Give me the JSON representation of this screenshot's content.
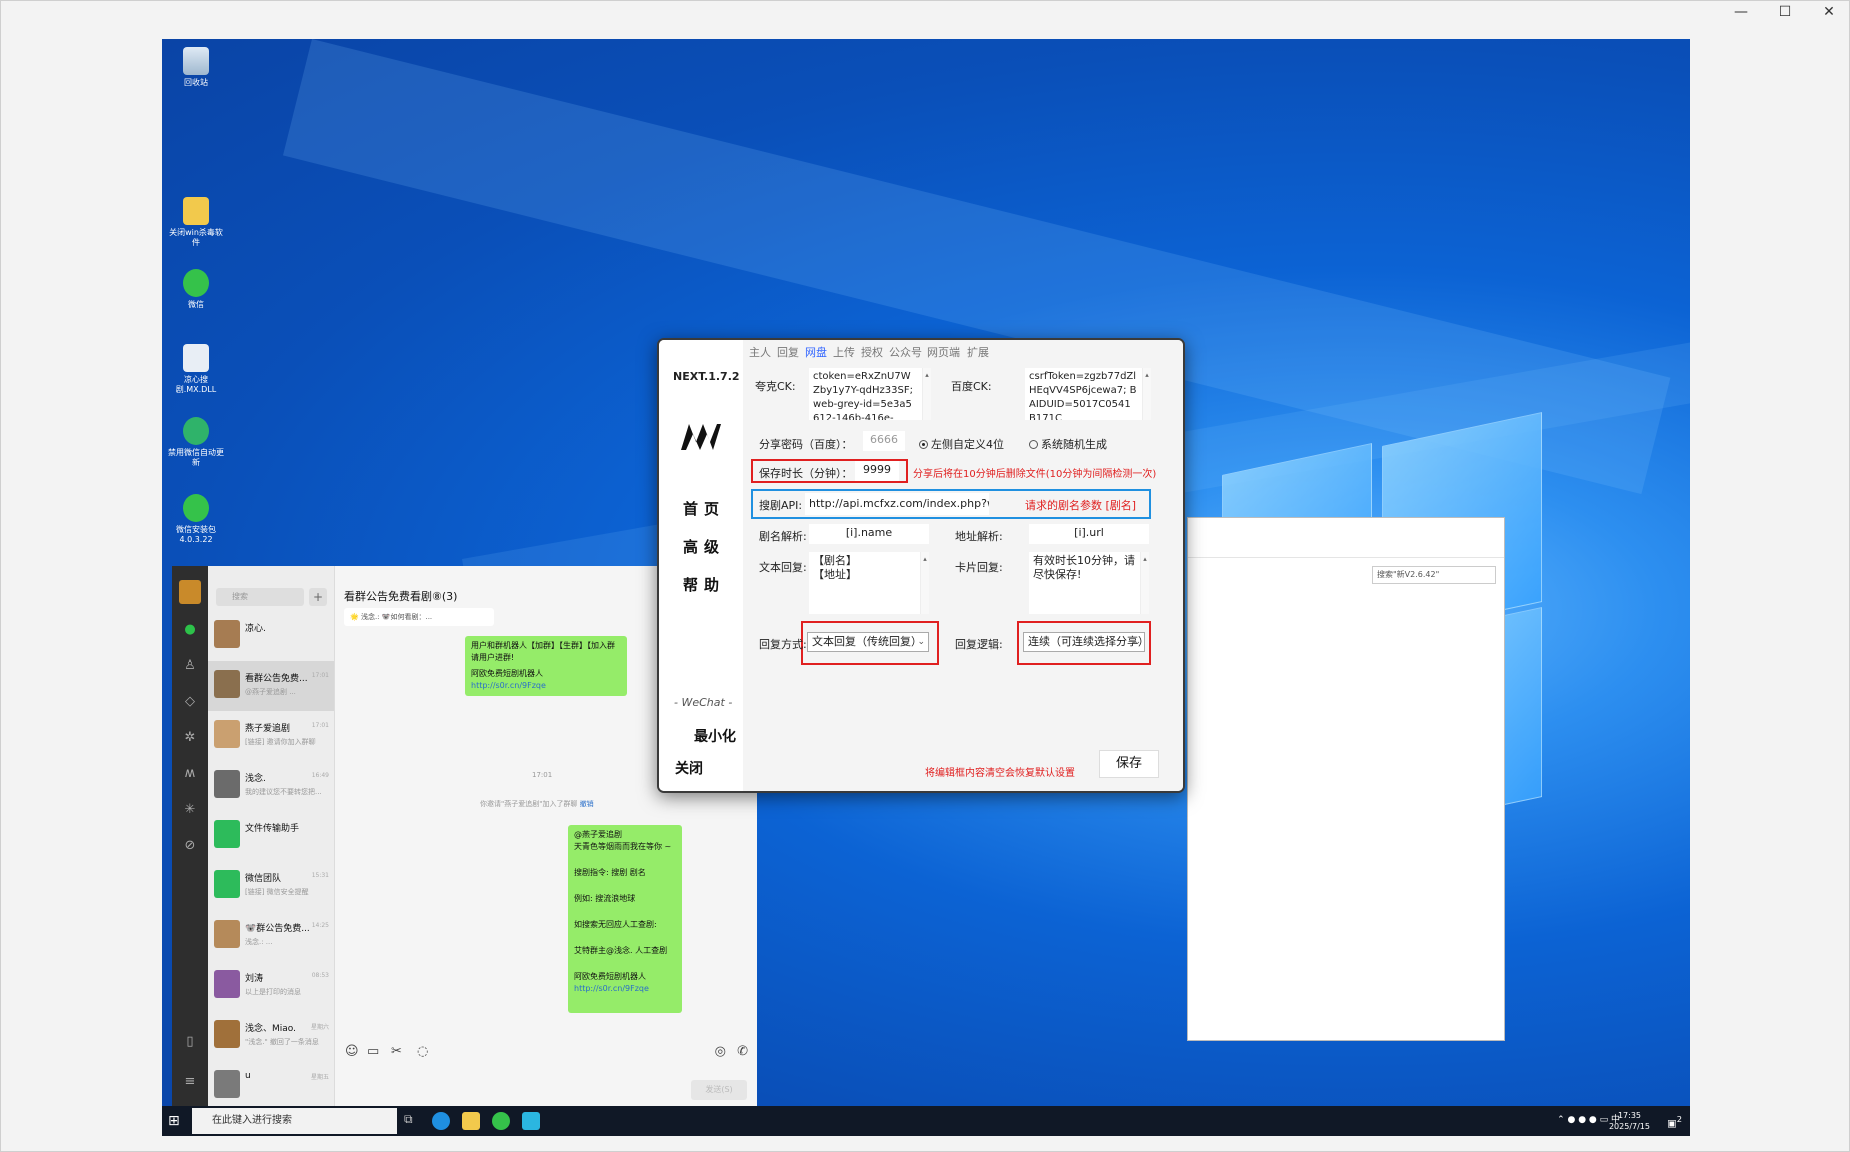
{
  "window": {
    "minimize": "—",
    "maximize": "☐",
    "close": "✕"
  },
  "desktop": {
    "icons": [
      {
        "label": "回收站"
      },
      {
        "label": "关闭win杀毒软件"
      },
      {
        "label": "微信"
      },
      {
        "label": "凉心搜剧.MX.DLL"
      },
      {
        "label": "禁用微信自动更新"
      },
      {
        "label": "微信安装包4.0.3.22"
      }
    ]
  },
  "taskbar": {
    "search_placeholder": "在此键入进行搜索",
    "time": "17:35",
    "date": "2025/7/15",
    "notif_count": "2"
  },
  "explorer": {
    "search_placeholder": "搜索\"新V2.6.42\""
  },
  "wechat": {
    "search_placeholder": "搜索",
    "plus": "+",
    "chat_title": "看群公告免费看剧⑧(3)",
    "pinned": "🌟 浅念.: 🐨如何看剧：...",
    "contacts": [
      {
        "name": "凉心.",
        "preview": "",
        "time": ""
      },
      {
        "name": "看群公告免费...",
        "preview": "@燕子爱追剧 ...",
        "time": "17:01"
      },
      {
        "name": "燕子爱追剧",
        "preview": "[链接] 邀请你加入群聊",
        "time": "17:01"
      },
      {
        "name": "浅念.",
        "preview": "我的建议您不要转您把...",
        "time": "16:49"
      },
      {
        "name": "文件传输助手",
        "preview": "",
        "time": ""
      },
      {
        "name": "微信团队",
        "preview": "[链接] 微信安全提醒",
        "time": "15:31"
      },
      {
        "name": "🐨群公告免费...",
        "preview": "浅念.: ...",
        "time": "14:25"
      },
      {
        "name": "刘涛",
        "preview": "以上是打印的消息",
        "time": "08:53"
      },
      {
        "name": "浅念、Miao.",
        "preview": "\"浅念.\" 撤回了一条消息",
        "time": "星期六"
      },
      {
        "name": "u",
        "preview": "",
        "time": "星期五"
      }
    ],
    "bubble1": {
      "line1": "用户和群机器人【加群】【生群】【加入群",
      "line2": "请用户进群!",
      "line3": "阿欧免费短剧机器人",
      "link": "http://s0r.cn/9Fzqe"
    },
    "sys_time": "17:01",
    "sys_msg": "你邀请\"燕子爱追剧\"加入了群聊",
    "sys_link": "撤销",
    "bubble2": {
      "l1": "@燕子爱追剧",
      "l2": "天青色等烟雨而我在等你 ~",
      "l3": "搜剧指令: 搜剧 剧名",
      "l4": "例如: 搜流浪地球",
      "l5": "如搜索无回应人工查剧:",
      "l6": "艾特群主@浅念. 人工查剧",
      "l7": "阿欧免费短剧机器人",
      "link": "http://s0r.cn/9Fzqe"
    },
    "send": "发送(S)"
  },
  "tool": {
    "version": "NEXT.1.7.2",
    "nav": {
      "home": "首页",
      "advanced": "高级",
      "help": "帮助"
    },
    "wechat_mark": "- WeChat -",
    "minimize": "最小化",
    "close": "关闭",
    "tabs": [
      "主人",
      "回复",
      "网盘",
      "上传",
      "授权",
      "公众号",
      "网页端",
      "扩展"
    ],
    "quark_label": "夸克CK:",
    "quark_value": "ctoken=eRxZnU7WZby1y7Y-qdHz33SF; web-grey-id=5e3a5612-146b-416e-",
    "baidu_label": "百度CK:",
    "baidu_value": "csrfToken=zgzb77dZlHEqVV4SP6jcewa7; BAIDUID=5017C0541B171C",
    "share_pwd_label": "分享密码（百度）：",
    "share_pwd_value": "6666",
    "radio_custom": "左侧自定义4位",
    "radio_random": "系统随机生成",
    "save_time_label": "保存时长（分钟）：",
    "save_time_value": "9999",
    "save_time_note": "分享后将在10分钟后删除文件(10分钟为间隔检测一次)",
    "api_label": "搜剧API:",
    "api_value": "http://api.mcfxz.com/index.php?word=[剧名]",
    "api_note": "请求的剧名参数 [剧名]",
    "name_parse_label": "剧名解析:",
    "name_parse_value": "[i].name",
    "url_parse_label": "地址解析:",
    "url_parse_value": "[i].url",
    "text_reply_label": "文本回复:",
    "text_reply_l1": "【剧名】",
    "text_reply_l2": "【地址】",
    "card_reply_label": "卡片回复:",
    "card_reply_value": "有效时长10分钟，请尽快保存!",
    "reply_mode_label": "回复方式:",
    "reply_mode_value": "文本回复（传统回复）",
    "reply_logic_label": "回复逻辑:",
    "reply_logic_value": "连续（可连续选择分享）",
    "reset_note": "将编辑框内容清空会恢复默认设置",
    "save": "保存"
  }
}
